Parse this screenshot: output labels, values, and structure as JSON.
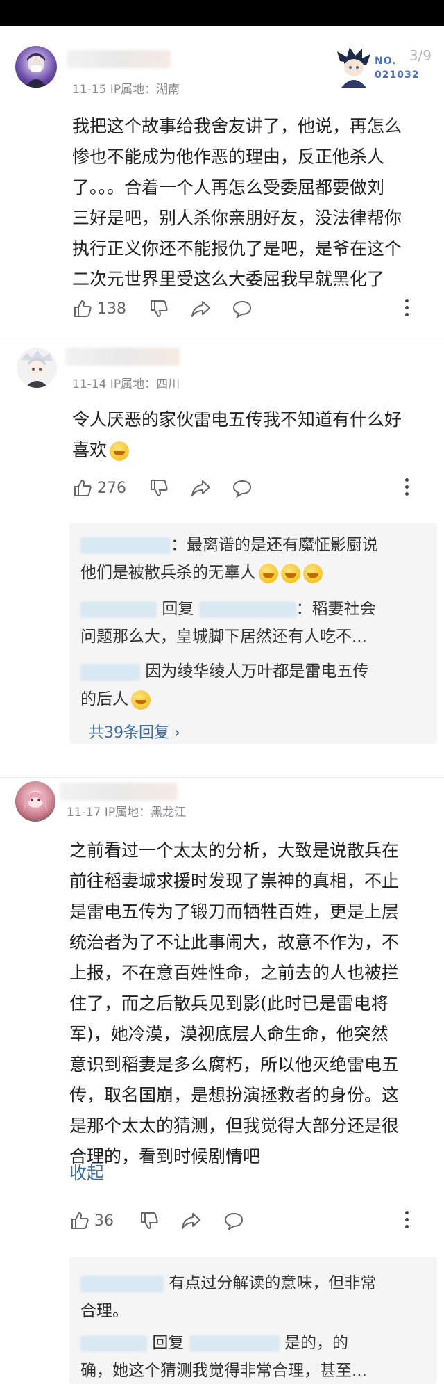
{
  "page_counter": "3/9",
  "badge": {
    "no_label": "NO.",
    "code": "021032"
  },
  "comments": [
    {
      "meta": "11-15 IP属地：湖南",
      "text": [
        "我把这个故事给我舍友讲了，他说，再怎么",
        "惨也不能成为他作恶的理由，反正他杀人",
        "了。。。合着一个人再怎么受委屈都要做刘",
        "三好是吧，别人杀你亲朋好友，没法律帮你",
        "执行正义你还不能报仇了是吧，是爷在这个",
        "二次元世界里受这么大委屈我早就黑化了"
      ],
      "likes": "138"
    },
    {
      "meta": "11-14 IP属地：四川",
      "text": [
        "令人厌恶的家伙雷电五传我不知道有什么好",
        "喜欢"
      ],
      "likes": "276",
      "replies": {
        "r1_a": "：最离谱的是还有魔怔影厨说",
        "r1_b": "他们是被散兵杀的无辜人",
        "r2_reply": "回复",
        "r2_a": "：稻妻社会",
        "r2_b": "问题那么大，皇城脚下居然还有人吃不...",
        "r3_a": "因为绫华绫人万叶都是雷电五传",
        "r3_b": "的后人",
        "total": "共39条回复 ›"
      }
    },
    {
      "meta": "11-17 IP属地：黑龙江",
      "text": [
        "之前看过一个太太的分析，大致是说散兵在",
        "前往稻妻城求援时发现了祟神的真相，不止",
        "是雷电五传为了锻刀而牺牲百姓，更是上层",
        "统治者为了不让此事闹大，故意不作为，不",
        "上报，不在意百姓性命，之前去的人也被拦",
        "住了，而之后散兵见到影(此时已是雷电将",
        "军)，她冷漠，漠视底层人命生命，他突然",
        "意识到稻妻是多么腐朽，所以他灭绝雷电五",
        "传，取名国崩，是想扮演拯救者的身份。这",
        "是那个太太的猜测，但我觉得大部分还是很",
        "合理的，看到时候剧情吧"
      ],
      "fold": "收起",
      "likes": "36",
      "replies": {
        "r1_a": "有点过分解读的意味，但非常",
        "r1_b": "合理。",
        "r2_reply": "回复",
        "r2_a": "是的，的",
        "r2_b": "确，她这个猜测我觉得非常合理，甚至..."
      }
    }
  ],
  "icons": [
    "thumb-up-icon",
    "thumb-down-icon",
    "share-icon",
    "comment-icon",
    "more-icon"
  ],
  "colors": {
    "link": "#3b6ea5",
    "meta": "#8a8a8a",
    "reply_bg": "#f5f5f5"
  }
}
